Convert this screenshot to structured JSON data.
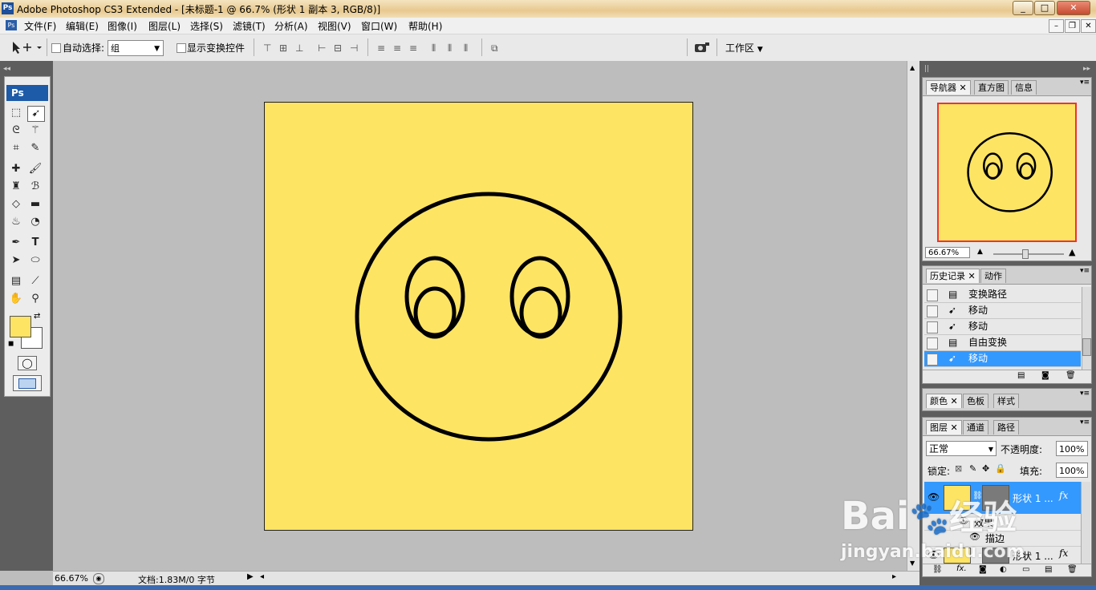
{
  "window": {
    "app_logo": "Ps",
    "title": "Adobe Photoshop CS3 Extended - [未标题-1 @ 66.7% (形状 1 副本 3, RGB/8)]",
    "controls": [
      "_",
      "□",
      "✕"
    ]
  },
  "menu": {
    "items": [
      "文件(F)",
      "编辑(E)",
      "图像(I)",
      "图层(L)",
      "选择(S)",
      "滤镜(T)",
      "分析(A)",
      "视图(V)",
      "窗口(W)",
      "帮助(H)"
    ]
  },
  "options": {
    "auto_select_label": "自动选择:",
    "auto_select_value": "组",
    "show_transform_label": "显示变换控件",
    "workspace_label": "工作区"
  },
  "tools": {
    "logo": "Ps",
    "foreground_color": "#fde463",
    "background_color": "#ffffff"
  },
  "document": {
    "background_color": "#fde463",
    "stroke_color": "#000000"
  },
  "status": {
    "zoom": "66.67%",
    "doc_info": "文档:1.83M/0 字节"
  },
  "navigator": {
    "tabs": [
      "导航器",
      "直方图",
      "信息"
    ],
    "zoom": "66.67%"
  },
  "history": {
    "tabs": [
      "历史记录",
      "动作"
    ],
    "items": [
      {
        "icon": "path-icon",
        "label": "变换路径"
      },
      {
        "icon": "move-icon",
        "label": "移动"
      },
      {
        "icon": "move-icon",
        "label": "移动"
      },
      {
        "icon": "path-icon",
        "label": "自由变换"
      },
      {
        "icon": "move-icon",
        "label": "移动"
      }
    ],
    "selected_index": 4
  },
  "color_panel": {
    "tabs": [
      "颜色",
      "色板",
      "样式"
    ]
  },
  "layers": {
    "tabs": [
      "图层",
      "通道",
      "路径"
    ],
    "blend_mode": "正常",
    "opacity_label": "不透明度:",
    "opacity": "100%",
    "lock_label": "锁定:",
    "fill_label": "填充:",
    "fill": "100%",
    "rows": [
      {
        "name": "形状 1 ..."
      },
      {
        "name": "效果"
      },
      {
        "name": "描边"
      },
      {
        "name": "形状 1 ..."
      }
    ]
  },
  "watermark": {
    "brand": "Bai",
    "brand_cn": "经验",
    "url": "jingyan.baidu.com"
  }
}
